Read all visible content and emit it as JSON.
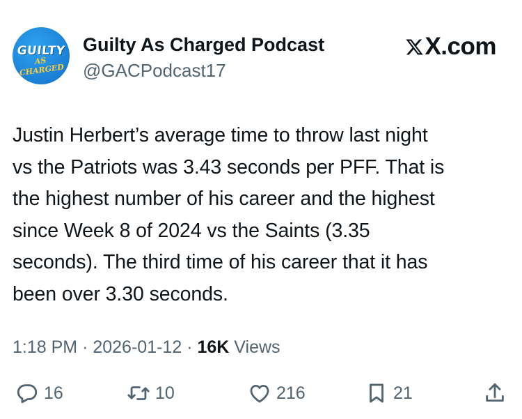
{
  "tweet": {
    "avatar_text_top": "GUILTY",
    "avatar_text_bottom": "AS CHARGED",
    "display_name": "Guilty As Charged Podcast",
    "handle": "@GACPodcast17",
    "brand": "X.com",
    "text": "Justin Herbert’s average time to throw last night\nvs the Patriots was 3.43 seconds per PFF. That is\nthe highest number of his career and the highest\nsince Week 8 of 2024 vs the Saints (3.35\nseconds). The third time of his career that it has\nbeen over 3.30 seconds.",
    "time": "1:18 PM",
    "date": "2026-01-12",
    "separator": "·",
    "views_count": "16K",
    "views_label": "Views"
  },
  "actions": {
    "replies": "16",
    "reposts": "10",
    "likes": "216",
    "bookmarks": "21"
  },
  "icons": [
    "reply-icon",
    "repost-icon",
    "like-icon",
    "bookmark-icon",
    "share-icon",
    "x-logo-icon"
  ],
  "colors": {
    "text": "#0f1419",
    "secondary": "#536471",
    "avatar_bg": "#1b7fd6",
    "avatar_accent": "#ffcc33"
  }
}
